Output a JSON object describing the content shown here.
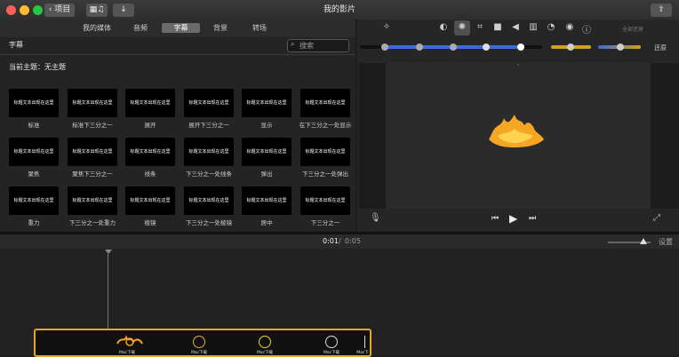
{
  "window": {
    "title": "我的影片",
    "back_label": "项目"
  },
  "browser": {
    "tabs": [
      {
        "label": "我的媒体",
        "active": false
      },
      {
        "label": "音频",
        "active": false
      },
      {
        "label": "字幕",
        "active": true
      },
      {
        "label": "背景",
        "active": false
      },
      {
        "label": "转场",
        "active": false
      }
    ],
    "category_title": "字幕",
    "search_placeholder": "搜索",
    "current_theme": "当前主题：无主题",
    "titles": [
      {
        "thumb": "标题文本出现在这里",
        "label": "标准"
      },
      {
        "thumb": "标题文本出现在这里",
        "label": "标准下三分之一"
      },
      {
        "thumb": "标题文本出现在这里",
        "label": "展开"
      },
      {
        "thumb": "标题文本出现在这里",
        "label": "展开下三分之一"
      },
      {
        "thumb": "标题文本出现在这里",
        "label": "显示"
      },
      {
        "thumb": "标题文本出现在这里",
        "label": "在下三分之一处显示"
      },
      {
        "thumb": "标题文本出现在这里",
        "label": "聚焦"
      },
      {
        "thumb": "标题文本出现在这里",
        "label": "聚焦下三分之一"
      },
      {
        "thumb": "标题文本出现在这里",
        "label": "线条"
      },
      {
        "thumb": "标题文本出现在这里",
        "label": "下三分之一处线条"
      },
      {
        "thumb": "标题文本出现在这里",
        "label": "弹出"
      },
      {
        "thumb": "标题文本出现在这里",
        "label": "下三分之一处弹出"
      },
      {
        "thumb": "标题文本出现在这里",
        "label": "重力"
      },
      {
        "thumb": "标题文本出现在这里",
        "label": "下三分之一处重力"
      },
      {
        "thumb": "标题文本出现在这里",
        "label": "棱镜"
      },
      {
        "thumb": "标题文本出现在这里",
        "label": "下三分之一处棱镜"
      },
      {
        "thumb": "标题文本出现在这里",
        "label": "居中"
      },
      {
        "thumb": "标题文本出现在这里",
        "label": "下三分之一"
      }
    ]
  },
  "viewer": {
    "auto_label": "全部还原",
    "reset_label": "还原",
    "tools": [
      "magic-wand",
      "color-balance",
      "color-correction",
      "crop",
      "stabilization",
      "volume",
      "noise-reduction",
      "speed",
      "info"
    ],
    "accent": "#f5a623"
  },
  "timeline": {
    "current_time": "0:01",
    "separator": "/",
    "total_time": "0:05",
    "settings_label": "设置",
    "clip_labels": [
      "Mac下载",
      "Mac下载",
      "Mac下载",
      "Mac下载",
      "Mac下"
    ]
  }
}
